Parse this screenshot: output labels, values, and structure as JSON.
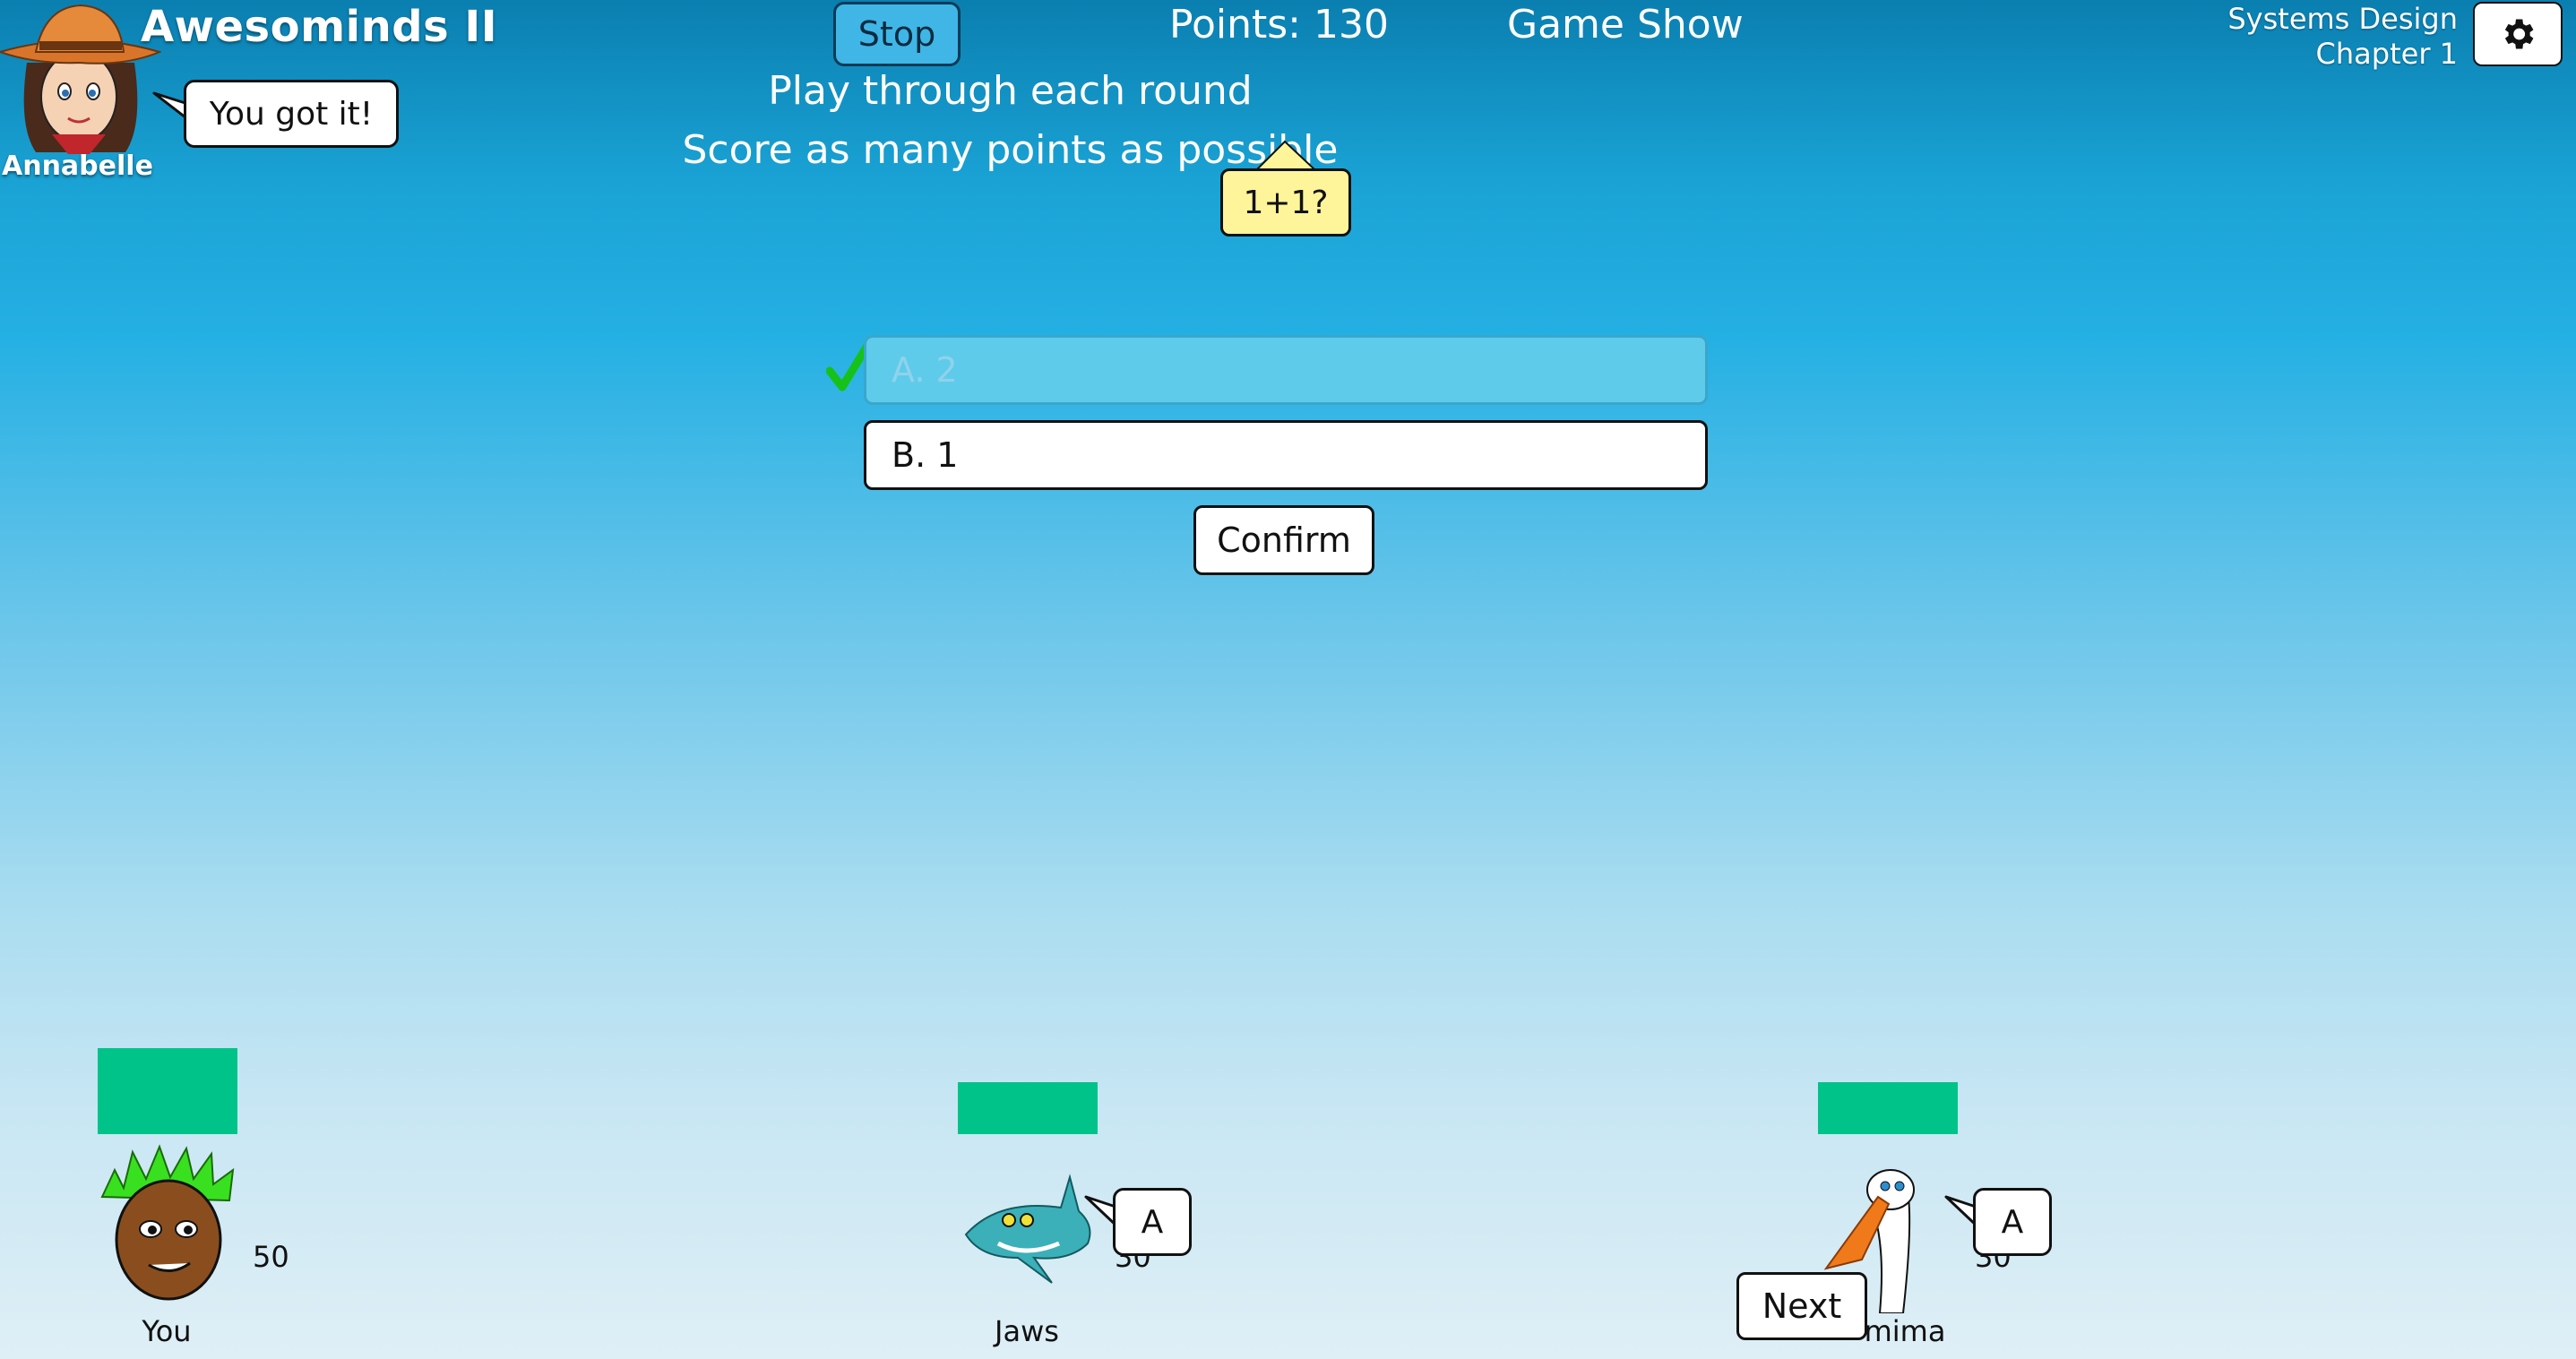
{
  "header": {
    "title": "Awesominds II",
    "stop_label": "Stop",
    "points_text": "Points: 130",
    "mode_text": "Game Show",
    "course_line1": "Systems Design",
    "course_line2": "Chapter 1",
    "settings_icon": "gear-icon"
  },
  "host": {
    "name": "Annabelle",
    "speech": "You got it!"
  },
  "instructions": {
    "line1": "Play through each round",
    "line2": "Score as many points as possible"
  },
  "question": {
    "text": "1+1?"
  },
  "answers": [
    {
      "label": "A. 2",
      "state": "selected-correct"
    },
    {
      "label": "B. 1",
      "state": "default"
    }
  ],
  "confirm_label": "Confirm",
  "next_label": "Next",
  "players": [
    {
      "name": "You",
      "score": "50",
      "bar_level": 1.0
    },
    {
      "name": "Jaws",
      "score": "30",
      "bar_level": 0.6,
      "answer": "A"
    },
    {
      "name": "mima",
      "score": "30",
      "bar_level": 0.6,
      "answer": "A"
    }
  ],
  "colors": {
    "bar": "#00c389",
    "question_bg": "#fef59a",
    "selected_answer_bg": "#5ecbeb",
    "check": "#16c21a"
  }
}
